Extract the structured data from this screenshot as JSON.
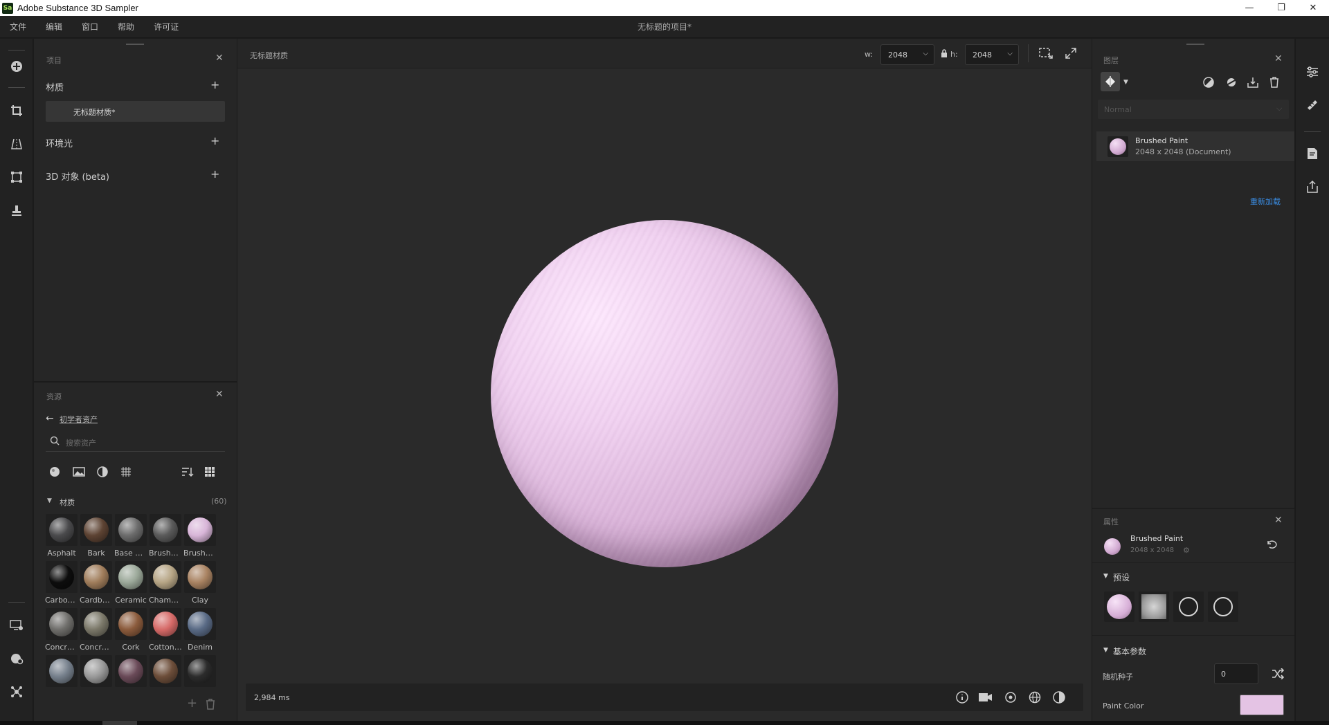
{
  "app": {
    "title": "Adobe Substance 3D Sampler",
    "logo_text": "Sa",
    "window_buttons": [
      "—",
      "❐",
      "✕"
    ]
  },
  "menu": {
    "items": [
      "文件",
      "编辑",
      "窗口",
      "帮助",
      "许可证"
    ],
    "document_title": "无标题的项目*"
  },
  "project_panel": {
    "header": "项目",
    "sections": [
      {
        "label": "材质",
        "add": "+"
      },
      {
        "label": "环境光",
        "add": "+"
      },
      {
        "label": "3D 对象 (beta)",
        "add": "+"
      }
    ],
    "material_item": "无标题材质*"
  },
  "assets_panel": {
    "header": "资源",
    "breadcrumb": "初学者资产",
    "search_placeholder": "搜索资产",
    "section_label": "材质",
    "section_count": "(60)",
    "items": [
      {
        "label": "Asphalt",
        "color": "#4a4a4c"
      },
      {
        "label": "Bark",
        "color": "#5d4333"
      },
      {
        "label": "Base M...",
        "color": "#6c6c6c"
      },
      {
        "label": "Brushe...",
        "color": "#5a5a5a"
      },
      {
        "label": "Brushe...",
        "color": "#d8b5d8"
      },
      {
        "label": "Carbon ...",
        "color": "#0d0d0d"
      },
      {
        "label": "Cardbo...",
        "color": "#a07d5b"
      },
      {
        "label": "Ceramic",
        "color": "#9ba899"
      },
      {
        "label": "Chamb...",
        "color": "#b6a585"
      },
      {
        "label": "Clay",
        "color": "#a98362"
      },
      {
        "label": "Concret...",
        "color": "#6f6e6b"
      },
      {
        "label": "Concret...",
        "color": "#7b7869"
      },
      {
        "label": "Cork",
        "color": "#8b5b3c"
      },
      {
        "label": "Cotton J...",
        "color": "#d66a68"
      },
      {
        "label": "Denim",
        "color": "#596a85"
      },
      {
        "label": "",
        "color": "#76808c"
      },
      {
        "label": "",
        "color": "#9a9a9a"
      },
      {
        "label": "",
        "color": "#6a4a58"
      },
      {
        "label": "",
        "color": "#6d4e3a"
      },
      {
        "label": "",
        "color": "#2c2c2c"
      }
    ]
  },
  "viewport": {
    "tab_title": "无标题材质",
    "w_label": "w:",
    "w_value": "2048",
    "h_label": "h:",
    "h_value": "2048",
    "render_time": "2,984 ms"
  },
  "layers_panel": {
    "header": "图层",
    "blend_mode": "Normal",
    "layer_name": "Brushed Paint",
    "layer_info": "2048 x 2048 (Document)",
    "reload_link": "重新加载"
  },
  "properties_panel": {
    "header": "属性",
    "name": "Brushed Paint",
    "size": "2048 x 2048",
    "presets_label": "预设",
    "basic_params_label": "基本参数",
    "seed_label": "随机种子",
    "seed_value": "0",
    "paint_color_label": "Paint Color",
    "paint_color": "#e4c3e4"
  },
  "colors": {
    "accent_link": "#3a8ee6",
    "sphere_tint": "#f1d2f1"
  }
}
